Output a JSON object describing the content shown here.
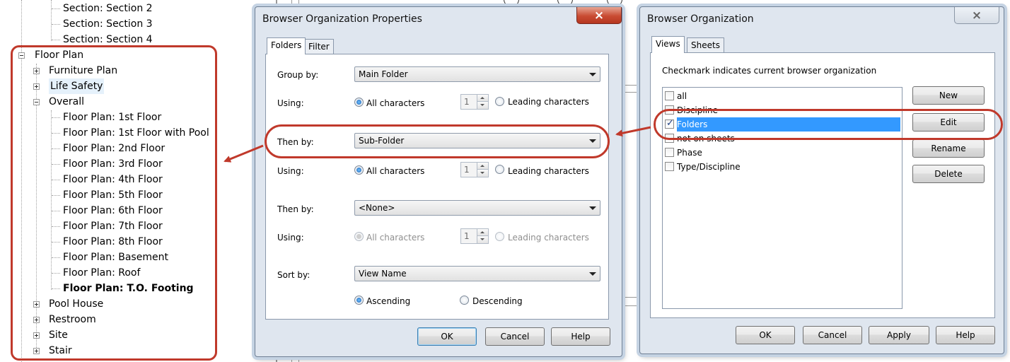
{
  "browser_tree": {
    "items": [
      {
        "label": "Section: Section 2",
        "level": 2,
        "bold": false
      },
      {
        "label": "Section: Section 3",
        "level": 2,
        "bold": false
      },
      {
        "label": "Section: Section 4",
        "level": 2,
        "bold": false
      },
      {
        "label": "Floor Plan",
        "level": 0,
        "expander": "minus",
        "bold": false
      },
      {
        "label": "Furniture Plan",
        "level": 1,
        "expander": "plus",
        "bold": false
      },
      {
        "label": "Life Safety",
        "level": 1,
        "expander": "plus",
        "bold": false,
        "hover": true
      },
      {
        "label": "Overall",
        "level": 1,
        "expander": "minus",
        "bold": false
      },
      {
        "label": "Floor Plan: 1st Floor",
        "level": 2,
        "bold": false
      },
      {
        "label": "Floor Plan: 1st Floor with Pool",
        "level": 2,
        "bold": false
      },
      {
        "label": "Floor Plan: 2nd Floor",
        "level": 2,
        "bold": false
      },
      {
        "label": "Floor Plan: 3rd Floor",
        "level": 2,
        "bold": false
      },
      {
        "label": "Floor Plan: 4th Floor",
        "level": 2,
        "bold": false
      },
      {
        "label": "Floor Plan: 5th Floor",
        "level": 2,
        "bold": false
      },
      {
        "label": "Floor Plan: 6th Floor",
        "level": 2,
        "bold": false
      },
      {
        "label": "Floor Plan: 7th Floor",
        "level": 2,
        "bold": false
      },
      {
        "label": "Floor Plan: 8th Floor",
        "level": 2,
        "bold": false
      },
      {
        "label": "Floor Plan: Basement",
        "level": 2,
        "bold": false
      },
      {
        "label": "Floor Plan: Roof",
        "level": 2,
        "bold": false
      },
      {
        "label": "Floor Plan: T.O. Footing",
        "level": 2,
        "bold": true
      },
      {
        "label": "Pool House",
        "level": 1,
        "expander": "plus",
        "bold": false
      },
      {
        "label": "Restroom",
        "level": 1,
        "expander": "plus",
        "bold": false
      },
      {
        "label": "Site",
        "level": 1,
        "expander": "plus",
        "bold": false
      },
      {
        "label": "Stair",
        "level": 1,
        "expander": "plus",
        "bold": false
      }
    ]
  },
  "props_dialog": {
    "title": "Browser Organization Properties",
    "close_icon": "×",
    "tabs": [
      "Folders",
      "Filter"
    ],
    "active_tab": "Folders",
    "group_by_label": "Group by:",
    "group_by_value": "Main Folder",
    "then_by_label": "Then by:",
    "then_by_1_value": "Sub-Folder",
    "then_by_2_value": "<None>",
    "sort_by_label": "Sort by:",
    "sort_by_value": "View Name",
    "using_label": "Using:",
    "all_characters": "All characters",
    "leading_characters": "Leading characters",
    "spin_value": "1",
    "ascending": "Ascending",
    "descending": "Descending",
    "ok": "OK",
    "cancel": "Cancel",
    "help": "Help"
  },
  "org_dialog": {
    "title": "Browser Organization",
    "close_icon": "×",
    "tabs": [
      "Views",
      "Sheets"
    ],
    "active_tab": "Views",
    "instruction": "Checkmark indicates current browser organization",
    "list": [
      {
        "label": "all",
        "checked": false
      },
      {
        "label": "Discipline",
        "checked": false
      },
      {
        "label": "Folders",
        "checked": true,
        "selected": true
      },
      {
        "label": "not on sheets",
        "checked": false
      },
      {
        "label": "Phase",
        "checked": false
      },
      {
        "label": "Type/Discipline",
        "checked": false
      }
    ],
    "new": "New",
    "edit": "Edit",
    "rename": "Rename",
    "delete": "Delete",
    "ok": "OK",
    "cancel": "Cancel",
    "apply": "Apply",
    "help": "Help"
  },
  "annotation_color": "#c0392b",
  "selection_color": "#3399ff"
}
